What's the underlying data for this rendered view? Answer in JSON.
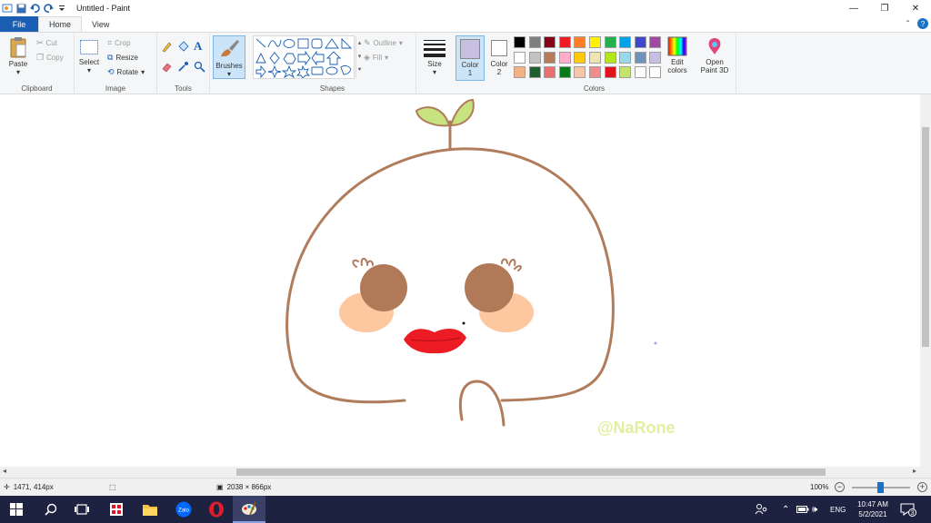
{
  "window": {
    "title": "Untitled - Paint"
  },
  "tabs": [
    {
      "label": "File"
    },
    {
      "label": "Home"
    },
    {
      "label": "View"
    }
  ],
  "clipboard": {
    "paste": "Paste",
    "cut": "Cut",
    "copy": "Copy",
    "label": "Clipboard"
  },
  "image": {
    "select": "Select",
    "crop": "Crop",
    "resize": "Resize",
    "rotate": "Rotate",
    "label": "Image"
  },
  "tools": {
    "label": "Tools"
  },
  "brushes": {
    "label": "Brushes"
  },
  "shapes": {
    "outline": "Outline",
    "fill": "Fill",
    "label": "Shapes"
  },
  "size": {
    "label": "Size"
  },
  "colors": {
    "color1": "Color",
    "color1_num": "1",
    "color2": "Color",
    "color2_num": "2",
    "edit_line1": "Edit",
    "edit_line2": "colors",
    "paint3d_line1": "Open",
    "paint3d_line2": "Paint 3D",
    "label": "Colors",
    "color1_value": "#c8c0e0",
    "color2_value": "#ffffff",
    "palette_row1": [
      "#000000",
      "#7f7f7f",
      "#880015",
      "#ed1c24",
      "#ff7f27",
      "#fff200",
      "#22b14c",
      "#00a2e8",
      "#3f48cc",
      "#a349a4"
    ],
    "palette_row2": [
      "#ffffff",
      "#c3c3c3",
      "#b97a57",
      "#ffaec9",
      "#ffc90e",
      "#efe4b0",
      "#b5e61d",
      "#99d9ea",
      "#7092be",
      "#c8bfe7"
    ],
    "palette_row3": [
      "#f4b183",
      "#1e5f2e",
      "#ee6e6e",
      "#0b7a1a",
      "#f7c6a8",
      "#f28b8b",
      "#e1121b",
      "#c4e36b",
      "#ffffff",
      "#ffffff"
    ]
  },
  "drawing": {
    "outline_color": "#b07c5c",
    "leaf_color": "#c6e37f",
    "eye_color": "#b07a58",
    "cheek_color": "#fdc8a0",
    "lips_color": "#ed1c24",
    "watermark": "@NaRone",
    "watermark_color": "#e0f0a0"
  },
  "status": {
    "cursor_pos": "1471, 414px",
    "canvas_size": "2038 × 866px",
    "zoom": "100%"
  },
  "taskbar": {
    "lang": "ENG",
    "time": "10:47 AM",
    "date": "5/2/2021",
    "notifications": "3"
  }
}
